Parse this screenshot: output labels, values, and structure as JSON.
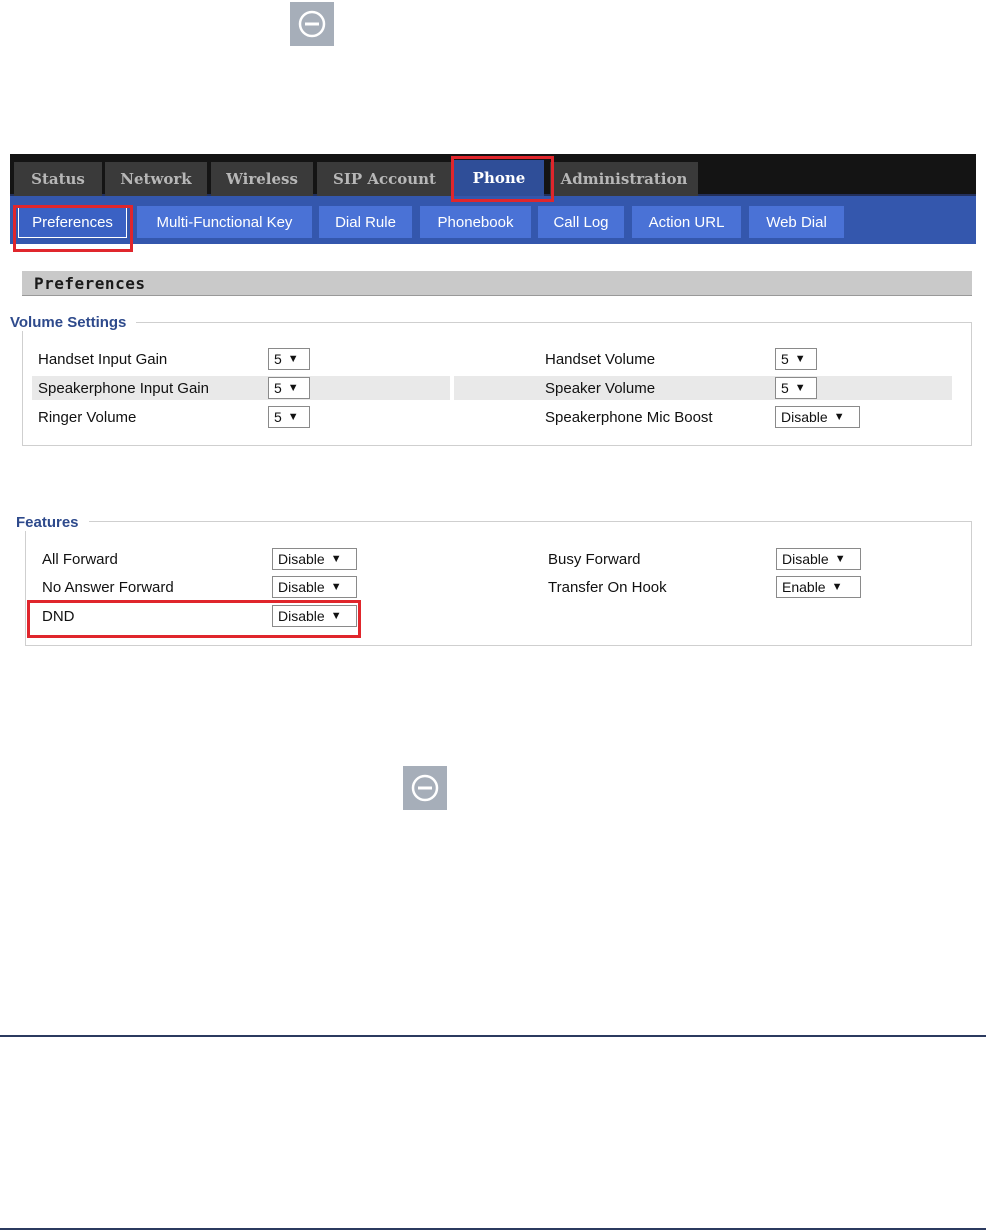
{
  "top_tabs": [
    {
      "label": "Status"
    },
    {
      "label": "Network"
    },
    {
      "label": "Wireless"
    },
    {
      "label": "SIP Account"
    },
    {
      "label": "Phone"
    },
    {
      "label": "Administration"
    }
  ],
  "active_top_tab": "Phone",
  "sub_tabs": [
    {
      "label": "Preferences"
    },
    {
      "label": "Multi-Functional Key"
    },
    {
      "label": "Dial Rule"
    },
    {
      "label": "Phonebook"
    },
    {
      "label": "Call Log"
    },
    {
      "label": "Action URL"
    },
    {
      "label": "Web Dial"
    }
  ],
  "active_sub_tab": "Preferences",
  "section_title": "Preferences",
  "volume_settings": {
    "legend": "Volume Settings",
    "rows": [
      {
        "left_label": "Handset Input Gain",
        "left_value": "5",
        "right_label": "Handset Volume",
        "right_value": "5"
      },
      {
        "left_label": "Speakerphone Input Gain",
        "left_value": "5",
        "right_label": "Speaker Volume",
        "right_value": "5"
      },
      {
        "left_label": "Ringer Volume",
        "left_value": "5",
        "right_label": "Speakerphone Mic Boost",
        "right_value": "Disable"
      }
    ]
  },
  "features": {
    "legend": "Features",
    "rows": [
      {
        "left_label": "All Forward",
        "left_value": "Disable",
        "right_label": "Busy Forward",
        "right_value": "Disable"
      },
      {
        "left_label": "No Answer Forward",
        "left_value": "Disable",
        "right_label": "Transfer On Hook",
        "right_value": "Enable"
      },
      {
        "left_label": "DND",
        "left_value": "Disable"
      }
    ]
  },
  "colors": {
    "highlight": "#e0262c",
    "active_tab": "#2f4e98",
    "subnav": "#3457ad",
    "legend_text": "#2e4a8c"
  },
  "icons": [
    "dnd-icon",
    "dnd-icon"
  ]
}
